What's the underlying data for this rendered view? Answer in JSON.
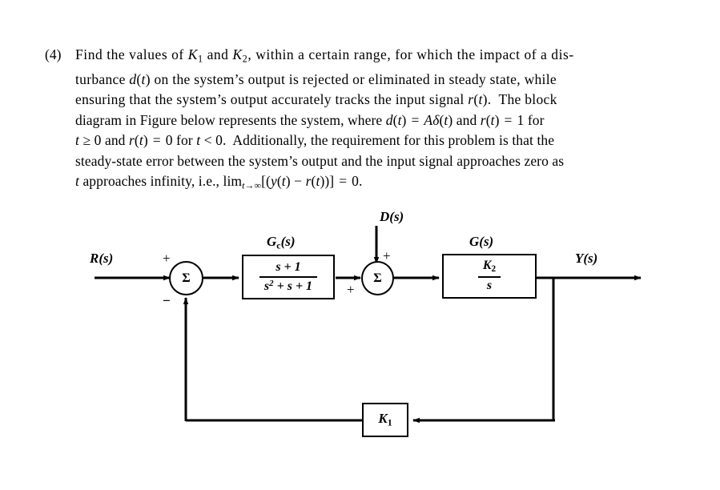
{
  "problem": {
    "number": "(4)",
    "lines": [
      "Find the values of K1 and K2, within a certain range, for which the impact of a dis-",
      "turbance d(t) on the system's output is rejected or eliminated in steady state, while",
      "ensuring that the system's output accurately tracks the input signal r(t).  The block",
      "diagram in Figure below represents the system, where d(t) = Aδ(t) and r(t) = 1 for",
      "t ≥ 0 and r(t) = 0 for t < 0.  Additionally, the requirement for this problem is that the",
      "steady-state error between the system's output and the input signal approaches zero as",
      "t approaches infinity, i.e., lim t→∞ [(y(t) − r(t))] = 0."
    ]
  },
  "diagram": {
    "input_label": "R(s)",
    "output_label": "Y(s)",
    "disturbance_label": "D(s)",
    "controller": {
      "name": "G",
      "name_sub": "c",
      "name_suffix": "(s)",
      "numerator": "s + 1",
      "denominator_base": "s",
      "denominator_exp": "2",
      "denominator_rest": "+ s + 1"
    },
    "plant": {
      "name": "G(s)",
      "numerator": "K",
      "numerator_sub": "2",
      "denominator": "s"
    },
    "feedback": {
      "gain": "K",
      "gain_sub": "1"
    },
    "signs": {
      "sum1_plus": "+",
      "sum1_minus": "−",
      "sum2_plus_top": "+",
      "sum2_plus_left": "+"
    },
    "sum_symbol": "Σ"
  },
  "colors": {
    "ink": "#000000",
    "paper": "#ffffff"
  }
}
